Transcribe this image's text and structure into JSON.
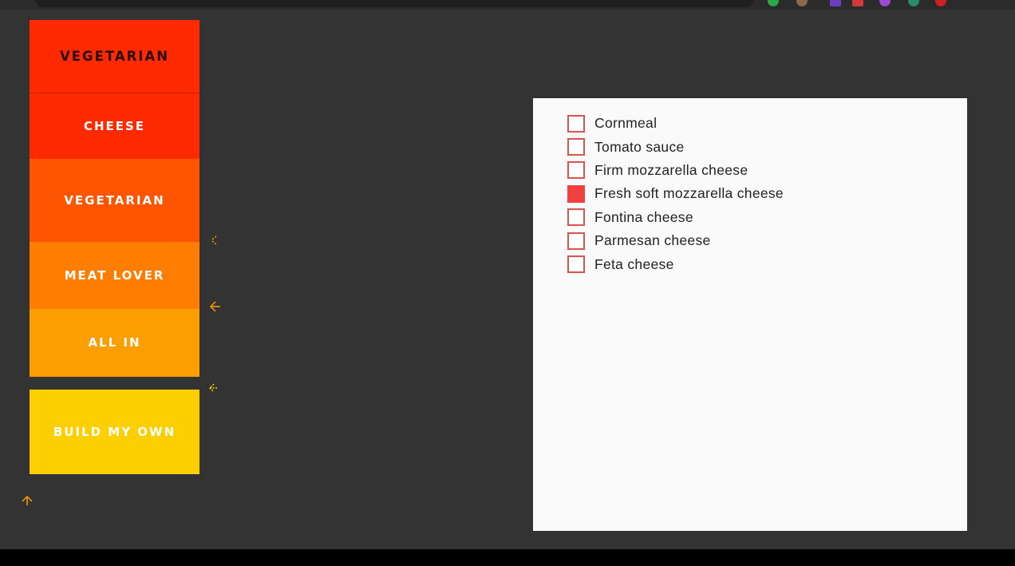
{
  "menu": {
    "items": [
      {
        "label": "VEGETARIAN",
        "color": "#ff2a00",
        "selected": true
      },
      {
        "label": "CHEESE",
        "color": "#ff2a00",
        "selected": false
      },
      {
        "label": "VEGETARIAN",
        "color": "#ff5500",
        "selected": false
      },
      {
        "label": "MEAT LOVER",
        "color": "#ff7d00",
        "selected": false
      },
      {
        "label": "ALL IN",
        "color": "#fb9f00",
        "selected": false
      },
      {
        "label": "BUILD MY OWN",
        "color": "#fccf00",
        "selected": false
      }
    ]
  },
  "ingredients": {
    "items": [
      {
        "label": "Cornmeal",
        "checked": false
      },
      {
        "label": "Tomato sauce",
        "checked": false
      },
      {
        "label": "Firm mozzarella cheese",
        "checked": false
      },
      {
        "label": "Fresh soft mozzarella cheese",
        "checked": true
      },
      {
        "label": "Fontina cheese",
        "checked": false
      },
      {
        "label": "Parmesan cheese",
        "checked": false
      },
      {
        "label": "Feta cheese",
        "checked": false
      }
    ]
  },
  "colors": {
    "page_background": "#333333",
    "panel_background": "#fafafa",
    "checkbox_border": "#d9534f",
    "checkbox_checked": "#f04040",
    "arrow": "#ff9a00"
  },
  "arrows": {
    "icons": [
      "arrow-left-icon",
      "arrow-left-icon",
      "arrow-left-icon",
      "arrow-up-icon"
    ]
  }
}
